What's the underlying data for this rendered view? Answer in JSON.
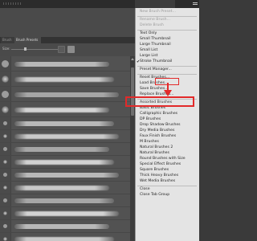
{
  "panel": {
    "tabs": [
      "Brush",
      "Brush Presets"
    ],
    "size_label": "Size:"
  },
  "menu": {
    "items": [
      {
        "label": "New Brush Preset...",
        "disabled": true
      },
      {
        "sep": true
      },
      {
        "label": "Rename Brush...",
        "disabled": true
      },
      {
        "label": "Delete Brush",
        "disabled": true
      },
      {
        "sep": true
      },
      {
        "label": "Text Only"
      },
      {
        "label": "Small Thumbnail"
      },
      {
        "label": "Large Thumbnail"
      },
      {
        "label": "Small List"
      },
      {
        "label": "Large List"
      },
      {
        "label": "Stroke Thumbnail",
        "checked": true
      },
      {
        "sep": true
      },
      {
        "label": "Preset Manager..."
      },
      {
        "sep": true
      },
      {
        "label": "Reset Brushes..."
      },
      {
        "label": "Load Brushes..."
      },
      {
        "label": "Save Brushes..."
      },
      {
        "label": "Replace Brushes..."
      },
      {
        "sep": true
      },
      {
        "label": "Assorted Brushes"
      },
      {
        "label": "Basic Brushes"
      },
      {
        "label": "Calligraphic Brushes"
      },
      {
        "label": "DP Brushes"
      },
      {
        "label": "Drop Shadow Brushes"
      },
      {
        "label": "Dry Media Brushes"
      },
      {
        "label": "Faux Finish Brushes"
      },
      {
        "label": "M Brushes"
      },
      {
        "label": "Natural Brushes 2"
      },
      {
        "label": "Natural Brushes"
      },
      {
        "label": "Round Brushes with Size"
      },
      {
        "label": "Special Effect Brushes"
      },
      {
        "label": "Square Brushes"
      },
      {
        "label": "Thick Heavy Brushes"
      },
      {
        "label": "Wet Media Brushes"
      },
      {
        "sep": true
      },
      {
        "label": "Close"
      },
      {
        "label": "Close Tab Group"
      }
    ]
  },
  "colors": {
    "highlight": "#e22a2a",
    "menu_bg": "#e4e4e4",
    "panel_bg": "#4a4a4a"
  },
  "icons": [
    "panel-menu-icon",
    "new-brush-icon",
    "folder-icon",
    "scroll-up-arrow-icon"
  ]
}
